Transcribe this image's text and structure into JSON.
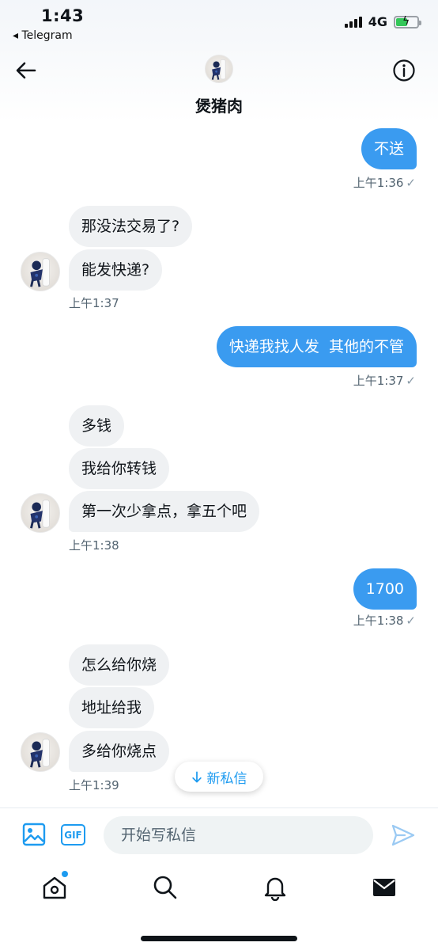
{
  "status_bar": {
    "time": "1:43",
    "back_app": "◂ Telegram",
    "network": "4G"
  },
  "header": {
    "name": "煲猪肉"
  },
  "messages": [
    {
      "dir": "out",
      "text": "不送"
    },
    {
      "ts": "上午1:36",
      "read": true
    },
    {
      "dir": "in",
      "text": "那没法交易了?"
    },
    {
      "dir": "in",
      "text": "能发快递?"
    },
    {
      "ts": "上午1:37"
    },
    {
      "dir": "out",
      "text": "快递我找人发  其他的不管"
    },
    {
      "ts": "上午1:37",
      "read": true
    },
    {
      "dir": "in",
      "text": "多钱"
    },
    {
      "dir": "in",
      "text": "我给你转钱"
    },
    {
      "dir": "in",
      "text": "第一次少拿点，拿五个吧"
    },
    {
      "ts": "上午1:38"
    },
    {
      "dir": "out",
      "text": "1700"
    },
    {
      "ts": "上午1:38",
      "read": true
    },
    {
      "dir": "in",
      "text": "怎么给你烧"
    },
    {
      "dir": "in",
      "text": "地址给我"
    },
    {
      "dir": "in",
      "text": "多给你烧点"
    },
    {
      "ts": "上午1:39"
    }
  ],
  "new_messages_pill": {
    "label": "新私信",
    "icon": "arrow-down-icon"
  },
  "composer": {
    "placeholder": "开始写私信",
    "gif_label": "GIF"
  },
  "tabs": [
    {
      "name": "home",
      "icon": "home-icon",
      "has_dot": true
    },
    {
      "name": "search",
      "icon": "search-icon"
    },
    {
      "name": "notifications",
      "icon": "bell-icon"
    },
    {
      "name": "messages",
      "icon": "mail-icon",
      "active": true
    }
  ],
  "colors": {
    "accent": "#1d9bf0",
    "outgoing_bubble": "#3a9bf0",
    "incoming_bubble": "#eff1f3",
    "timestamp": "#536471"
  }
}
